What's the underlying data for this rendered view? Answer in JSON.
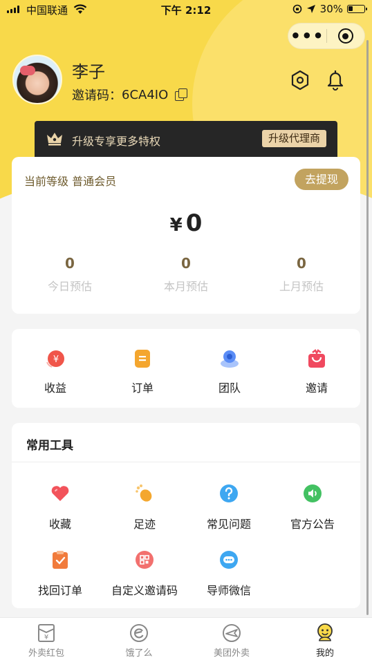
{
  "status_bar": {
    "carrier": "中国联通",
    "time": "下午 2:12",
    "battery": "30%",
    "battery_level": 0.3
  },
  "capsule": {
    "more_label": "•••"
  },
  "profile": {
    "name": "李子",
    "invite_label": "邀请码：",
    "invite_code": "6CA4IO"
  },
  "upgrade": {
    "text": "升级专享更多特权",
    "button": "升级代理商"
  },
  "level_card": {
    "level_label": "当前等级",
    "level_value": "普通会员",
    "withdraw_button": "去提现",
    "currency": "¥",
    "balance": "0",
    "stats": [
      {
        "value": "0",
        "label": "今日预估"
      },
      {
        "value": "0",
        "label": "本月预估"
      },
      {
        "value": "0",
        "label": "上月预估"
      }
    ]
  },
  "actions": [
    {
      "label": "收益",
      "icon": "income-icon",
      "color": "#f0554a"
    },
    {
      "label": "订单",
      "icon": "order-icon",
      "color": "#f4a62e"
    },
    {
      "label": "团队",
      "icon": "team-icon",
      "color": "#5b8df6"
    },
    {
      "label": "邀请",
      "icon": "invite-gift-icon",
      "color": "#f0495f"
    }
  ],
  "tools": {
    "title": "常用工具",
    "items": [
      {
        "label": "收藏",
        "icon": "heart-icon",
        "color": "#f2535b"
      },
      {
        "label": "足迹",
        "icon": "footprint-icon",
        "color": "#f4a72e"
      },
      {
        "label": "常见问题",
        "icon": "question-icon",
        "color": "#3ea7f1"
      },
      {
        "label": "官方公告",
        "icon": "speaker-icon",
        "color": "#43c162"
      },
      {
        "label": "找回订单",
        "icon": "recover-order-icon",
        "color": "#f17b3c"
      },
      {
        "label": "自定义邀请码",
        "icon": "qr-code-icon",
        "color": "#f2706e"
      },
      {
        "label": "导师微信",
        "icon": "chat-icon",
        "color": "#3ea7f1"
      }
    ]
  },
  "tabbar": [
    {
      "label": "外卖红包",
      "icon": "red-packet-icon",
      "active": false
    },
    {
      "label": "饿了么",
      "icon": "eleme-icon",
      "active": false
    },
    {
      "label": "美团外卖",
      "icon": "meituan-icon",
      "active": false
    },
    {
      "label": "我的",
      "icon": "mine-icon",
      "active": true
    }
  ]
}
